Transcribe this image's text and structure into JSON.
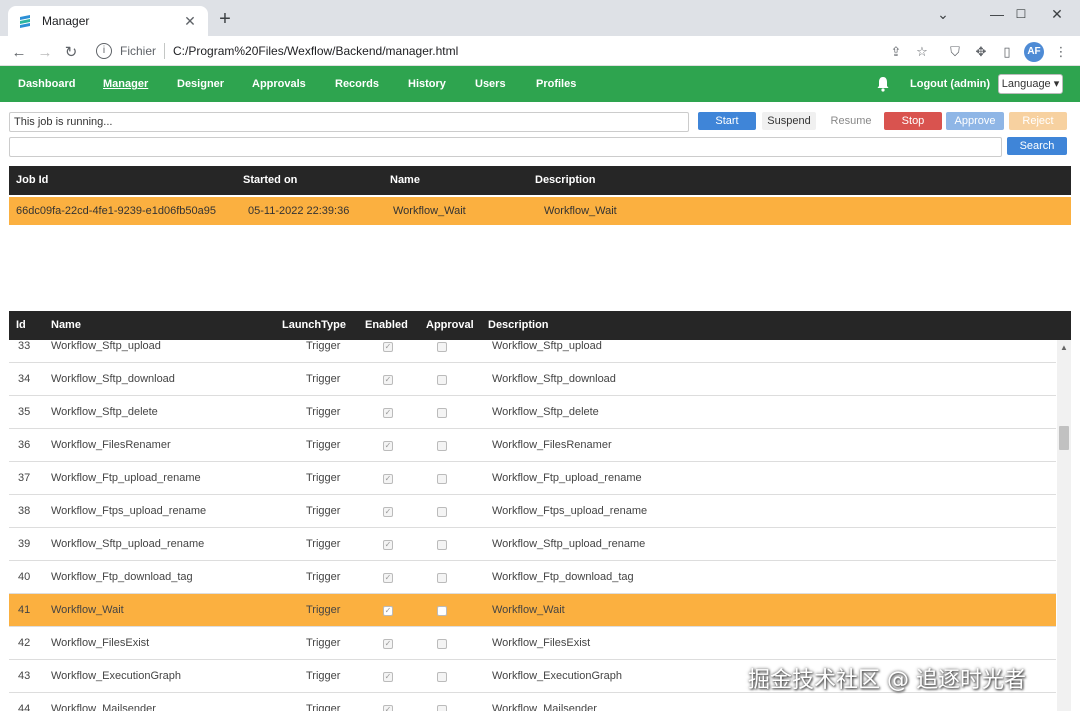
{
  "browser": {
    "tab_title": "Manager",
    "scheme_label": "Fichier",
    "url": "C:/Program%20Files/Wexflow/Backend/manager.html",
    "avatar_initials": "AF"
  },
  "nav": {
    "items": [
      "Dashboard",
      "Manager",
      "Designer",
      "Approvals",
      "Records",
      "History",
      "Users",
      "Profiles"
    ],
    "logout": "Logout (admin)",
    "language": "Language ▾"
  },
  "controls": {
    "status_text": "This job is running...",
    "start": "Start",
    "suspend": "Suspend",
    "resume": "Resume",
    "stop": "Stop",
    "approve": "Approve",
    "reject": "Reject",
    "search": "Search"
  },
  "running_jobs": {
    "headers": [
      "Job Id",
      "Started on",
      "Name",
      "Description"
    ],
    "rows": [
      {
        "job_id": "66dc09fa-22cd-4fe1-9239-e1d06fb50a95",
        "started_on": "05-11-2022 22:39:36",
        "name": "Workflow_Wait",
        "description": "Workflow_Wait"
      }
    ]
  },
  "workflows": {
    "headers": [
      "Id",
      "Name",
      "LaunchType",
      "Enabled",
      "Approval",
      "Description"
    ],
    "selected_id": "41",
    "rows": [
      {
        "id": "33",
        "name": "Workflow_Sftp_upload",
        "launch": "Trigger",
        "description": "Workflow_Sftp_upload"
      },
      {
        "id": "34",
        "name": "Workflow_Sftp_download",
        "launch": "Trigger",
        "description": "Workflow_Sftp_download"
      },
      {
        "id": "35",
        "name": "Workflow_Sftp_delete",
        "launch": "Trigger",
        "description": "Workflow_Sftp_delete"
      },
      {
        "id": "36",
        "name": "Workflow_FilesRenamer",
        "launch": "Trigger",
        "description": "Workflow_FilesRenamer"
      },
      {
        "id": "37",
        "name": "Workflow_Ftp_upload_rename",
        "launch": "Trigger",
        "description": "Workflow_Ftp_upload_rename"
      },
      {
        "id": "38",
        "name": "Workflow_Ftps_upload_rename",
        "launch": "Trigger",
        "description": "Workflow_Ftps_upload_rename"
      },
      {
        "id": "39",
        "name": "Workflow_Sftp_upload_rename",
        "launch": "Trigger",
        "description": "Workflow_Sftp_upload_rename"
      },
      {
        "id": "40",
        "name": "Workflow_Ftp_download_tag",
        "launch": "Trigger",
        "description": "Workflow_Ftp_download_tag"
      },
      {
        "id": "41",
        "name": "Workflow_Wait",
        "launch": "Trigger",
        "description": "Workflow_Wait"
      },
      {
        "id": "42",
        "name": "Workflow_FilesExist",
        "launch": "Trigger",
        "description": "Workflow_FilesExist"
      },
      {
        "id": "43",
        "name": "Workflow_ExecutionGraph",
        "launch": "Trigger",
        "description": "Workflow_ExecutionGraph"
      },
      {
        "id": "44",
        "name": "Workflow_Mailsender",
        "launch": "Trigger",
        "description": "Workflow_Mailsender"
      }
    ]
  },
  "watermark": "掘金技术社区 @ 追逐时光者",
  "colors": {
    "nav_green": "#2ea44f",
    "selected_orange": "#fbb040",
    "header_dark": "#262626",
    "primary_blue": "#3f85d8",
    "danger_red": "#d9534f"
  }
}
